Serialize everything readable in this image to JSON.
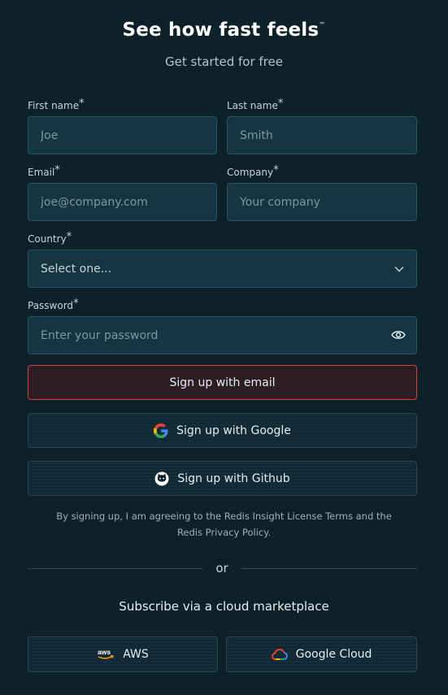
{
  "header": {
    "title": "See how fast feels",
    "trademark": "™",
    "subtitle": "Get started for free"
  },
  "form": {
    "required_mark": "*",
    "first_name": {
      "label": "First name",
      "placeholder": "Joe"
    },
    "last_name": {
      "label": "Last name",
      "placeholder": "Smith"
    },
    "email": {
      "label": "Email",
      "placeholder": "joe@company.com"
    },
    "company": {
      "label": "Company",
      "placeholder": "Your company"
    },
    "country": {
      "label": "Country",
      "selected": "Select one..."
    },
    "password": {
      "label": "Password",
      "placeholder": "Enter your password"
    }
  },
  "buttons": {
    "email": "Sign up with email",
    "google": "Sign up with Google",
    "github": "Sign up with Github"
  },
  "legal": {
    "text": "By signing up, I am agreeing to the Redis Insight License Terms and the Redis Privacy Policy."
  },
  "divider": {
    "label": "or"
  },
  "marketplace": {
    "heading": "Subscribe via a cloud marketplace",
    "aws": "AWS",
    "gcp": "Google Cloud"
  },
  "colors": {
    "background": "#0d212b",
    "input_bg": "#163542",
    "email_button_border": "#d63d3d"
  },
  "icons": [
    "google-icon",
    "github-icon",
    "aws-icon",
    "google-cloud-icon",
    "eye-icon",
    "chevron-down-icon"
  ]
}
